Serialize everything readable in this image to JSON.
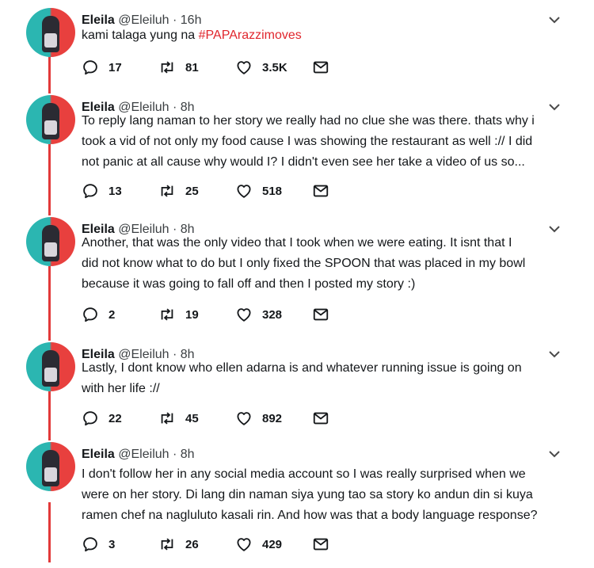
{
  "tweets": [
    {
      "name": "Eleila",
      "handle": "@Eleiluh",
      "time": "· 16h",
      "text_pre": "kami talaga yung na ",
      "hashtag": "#PAPArazzimoves",
      "lines": [],
      "replies": "17",
      "retweets": "81",
      "likes": "3.5K"
    },
    {
      "name": "Eleila",
      "handle": "@Eleiluh",
      "time": "· 8h",
      "lines": [
        "To reply lang naman to her story  we really had no clue she was there. thats why i",
        "took a vid of not only my food cause I was showing the restaurant as well :// I did",
        "not panic at all cause why would I? I didn't even see her take a video of us so..."
      ],
      "replies": "13",
      "retweets": "25",
      "likes": "518"
    },
    {
      "name": "Eleila",
      "handle": "@Eleiluh",
      "time": "· 8h",
      "lines": [
        "Another, that was the only video that I took when we were eating. It isnt that I",
        "did not know what to do but I only fixed the SPOON that was placed in my bowl",
        "because it was going to fall off and then I posted my story :)"
      ],
      "replies": "2",
      "retweets": "19",
      "likes": "328"
    },
    {
      "name": "Eleila",
      "handle": "@Eleiluh",
      "time": "· 8h",
      "lines": [
        "Lastly, I dont know who ellen adarna is and whatever running issue is going on",
        "with her life ://"
      ],
      "replies": "22",
      "retweets": "45",
      "likes": "892"
    },
    {
      "name": "Eleila",
      "handle": "@Eleiluh",
      "time": "· 8h",
      "lines": [
        "I don't follow her in any social media account so I was really surprised when we",
        "were on her story. Di lang din naman siya yung tao sa story ko andun din si kuya",
        "ramen chef na nagluluto kasali rin. And how was that a body language response?"
      ],
      "replies": "3",
      "retweets": "26",
      "likes": "429"
    }
  ],
  "icons": {
    "reply": "reply-icon",
    "retweet": "retweet-icon",
    "like": "heart-icon",
    "dm": "mail-icon",
    "menu": "chevron-down-icon"
  },
  "colors": {
    "thread_line": "#e23a3a",
    "hashtag": "#e0262d"
  }
}
